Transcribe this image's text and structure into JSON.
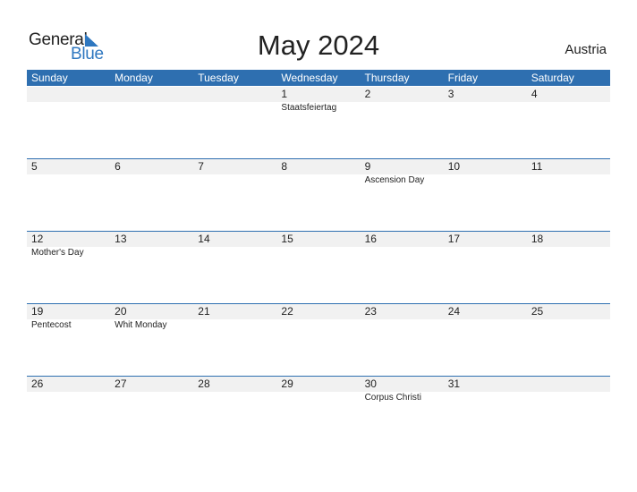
{
  "logo": {
    "general": "General",
    "blue": "Blue",
    "accent_color": "#2e77c0"
  },
  "title": "May 2024",
  "country": "Austria",
  "header_color": "#2e6fb0",
  "weekdays": [
    "Sunday",
    "Monday",
    "Tuesday",
    "Wednesday",
    "Thursday",
    "Friday",
    "Saturday"
  ],
  "weeks": [
    {
      "days": [
        {
          "num": "",
          "holiday": ""
        },
        {
          "num": "",
          "holiday": ""
        },
        {
          "num": "",
          "holiday": ""
        },
        {
          "num": "1",
          "holiday": "Staatsfeiertag"
        },
        {
          "num": "2",
          "holiday": ""
        },
        {
          "num": "3",
          "holiday": ""
        },
        {
          "num": "4",
          "holiday": ""
        }
      ]
    },
    {
      "days": [
        {
          "num": "5",
          "holiday": ""
        },
        {
          "num": "6",
          "holiday": ""
        },
        {
          "num": "7",
          "holiday": ""
        },
        {
          "num": "8",
          "holiday": ""
        },
        {
          "num": "9",
          "holiday": "Ascension Day"
        },
        {
          "num": "10",
          "holiday": ""
        },
        {
          "num": "11",
          "holiday": ""
        }
      ]
    },
    {
      "days": [
        {
          "num": "12",
          "holiday": "Mother's Day"
        },
        {
          "num": "13",
          "holiday": ""
        },
        {
          "num": "14",
          "holiday": ""
        },
        {
          "num": "15",
          "holiday": ""
        },
        {
          "num": "16",
          "holiday": ""
        },
        {
          "num": "17",
          "holiday": ""
        },
        {
          "num": "18",
          "holiday": ""
        }
      ]
    },
    {
      "days": [
        {
          "num": "19",
          "holiday": "Pentecost"
        },
        {
          "num": "20",
          "holiday": "Whit Monday"
        },
        {
          "num": "21",
          "holiday": ""
        },
        {
          "num": "22",
          "holiday": ""
        },
        {
          "num": "23",
          "holiday": ""
        },
        {
          "num": "24",
          "holiday": ""
        },
        {
          "num": "25",
          "holiday": ""
        }
      ]
    },
    {
      "days": [
        {
          "num": "26",
          "holiday": ""
        },
        {
          "num": "27",
          "holiday": ""
        },
        {
          "num": "28",
          "holiday": ""
        },
        {
          "num": "29",
          "holiday": ""
        },
        {
          "num": "30",
          "holiday": "Corpus Christi"
        },
        {
          "num": "31",
          "holiday": ""
        },
        {
          "num": "",
          "holiday": ""
        }
      ]
    }
  ]
}
